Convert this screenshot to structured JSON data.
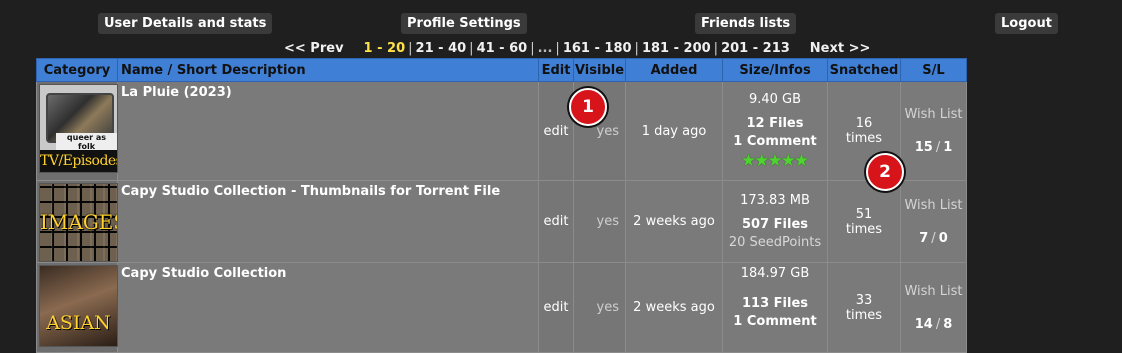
{
  "nav": {
    "user_details": "User Details and stats",
    "profile_settings": "Profile Settings",
    "friends_lists": "Friends lists",
    "logout": "Logout"
  },
  "pager": {
    "prev": "<< Prev",
    "current": "1 - 20",
    "p2": "21 - 40",
    "p3": "41 - 60",
    "ellipsis": "...",
    "p9": "161 - 180",
    "p10": "181 - 200",
    "p11": "201 - 213",
    "next": "Next >>",
    "sep": "|"
  },
  "table": {
    "headers": {
      "category": "Category",
      "name": "Name / Short Description",
      "edit": "Edit",
      "visible": "Visible",
      "added": "Added",
      "size": "Size/Infos",
      "snatched": "Snatched",
      "sl": "S/L"
    },
    "rows": [
      {
        "category_caption": "TV/Episodes",
        "category_logo": "queer as folk",
        "name": "La Pluie (2023)",
        "edit": "edit",
        "visible": "yes",
        "added": "1 day ago",
        "size": "9.40 GB",
        "files": "12 Files",
        "comments": "1 Comment",
        "rating_stars": 5,
        "snatched_count": "16",
        "snatched_unit": "times",
        "wish": "Wish List",
        "seeders": "15",
        "leechers": "1"
      },
      {
        "category_caption": "IMAGES",
        "name": "Capy Studio Collection - Thumbnails for Torrent File",
        "edit": "edit",
        "visible": "yes",
        "added": "2 weeks ago",
        "size": "173.83 MB",
        "files": "507 Files",
        "seedpoints": "20 SeedPoints",
        "snatched_count": "51",
        "snatched_unit": "times",
        "wish": "Wish List",
        "seeders": "7",
        "leechers": "0"
      },
      {
        "category_caption": "ASIAN",
        "name": "Capy Studio Collection",
        "edit": "edit",
        "visible": "yes",
        "added": "2 weeks ago",
        "size": "184.97 GB",
        "files": "113 Files",
        "comments": "1 Comment",
        "snatched_count": "33",
        "snatched_unit": "times",
        "wish": "Wish List",
        "seeders": "14",
        "leechers": "8"
      }
    ]
  },
  "markers": [
    "1",
    "2"
  ],
  "colors": {
    "background": "#1f1f1f",
    "header": "#3f7fd6",
    "row": "#7a7a7a",
    "current_page": "#ffe14a",
    "marker": "#d8141b",
    "star": "#4fd42f"
  },
  "icons": {
    "rating": "star-icon"
  }
}
